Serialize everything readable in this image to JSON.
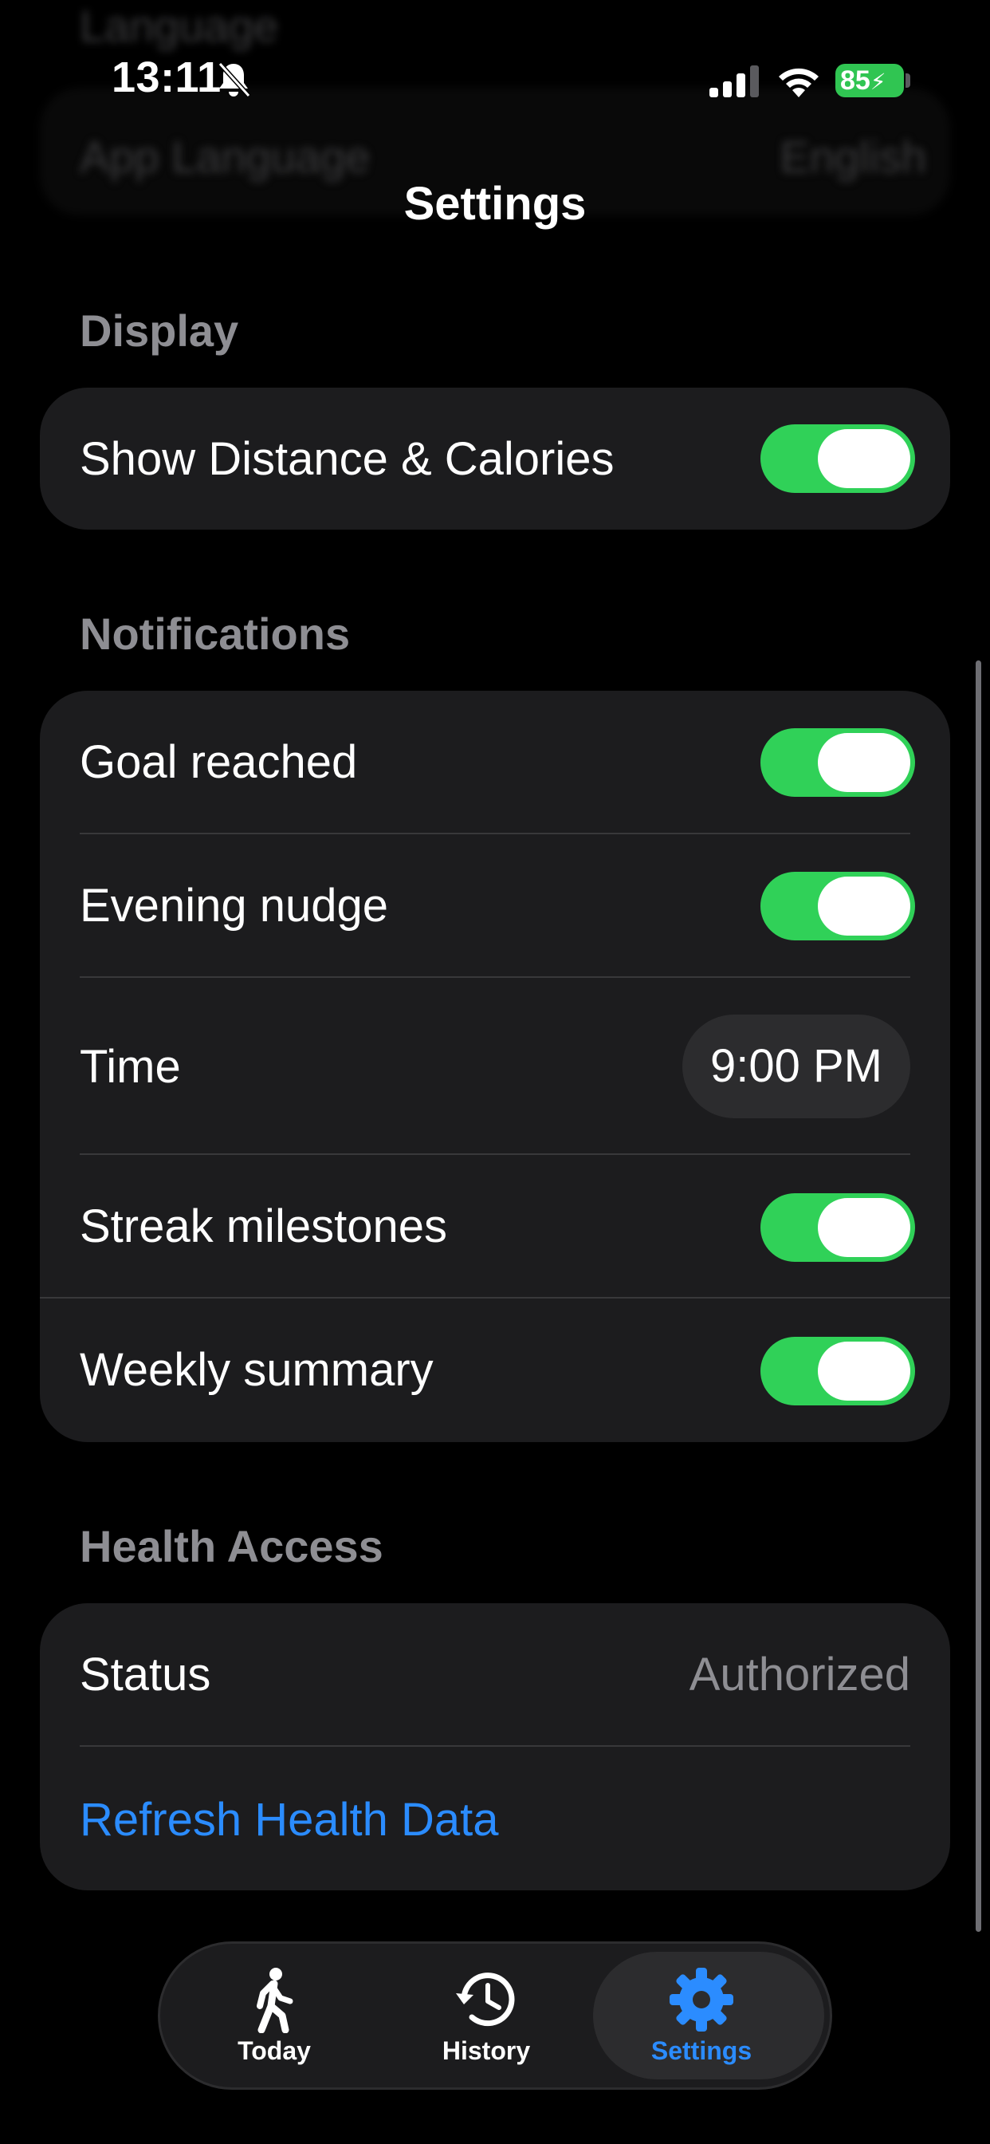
{
  "background_ghost": {
    "header_text": "Language",
    "row_label": "App Language",
    "row_value": "English"
  },
  "status_bar": {
    "time": "13:11",
    "battery": "85"
  },
  "nav": {
    "title": "Settings"
  },
  "display": {
    "header": "Display",
    "show_distance": {
      "label": "Show Distance & Calories",
      "on": true
    }
  },
  "notifications": {
    "header": "Notifications",
    "goal_reached": {
      "label": "Goal reached",
      "on": true
    },
    "evening_nudge": {
      "label": "Evening nudge",
      "on": true
    },
    "time": {
      "label": "Time",
      "value": "9:00 PM"
    },
    "streak_milestones": {
      "label": "Streak milestones",
      "on": true
    },
    "weekly_summary": {
      "label": "Weekly summary",
      "on": true
    }
  },
  "health": {
    "header": "Health Access",
    "status": {
      "label": "Status",
      "value": "Authorized"
    },
    "refresh_label": "Refresh Health Data"
  },
  "tabbar": {
    "today": "Today",
    "history": "History",
    "settings": "Settings",
    "active": "settings"
  },
  "colors": {
    "accent": "#2b8cff",
    "toggle_on": "#30d158",
    "group_bg": "#1c1c1e",
    "secondary_text": "#8e8e93"
  },
  "icons": {
    "today": "figure-walk-icon",
    "history": "clock-arrow-icon",
    "settings": "gear-icon"
  }
}
